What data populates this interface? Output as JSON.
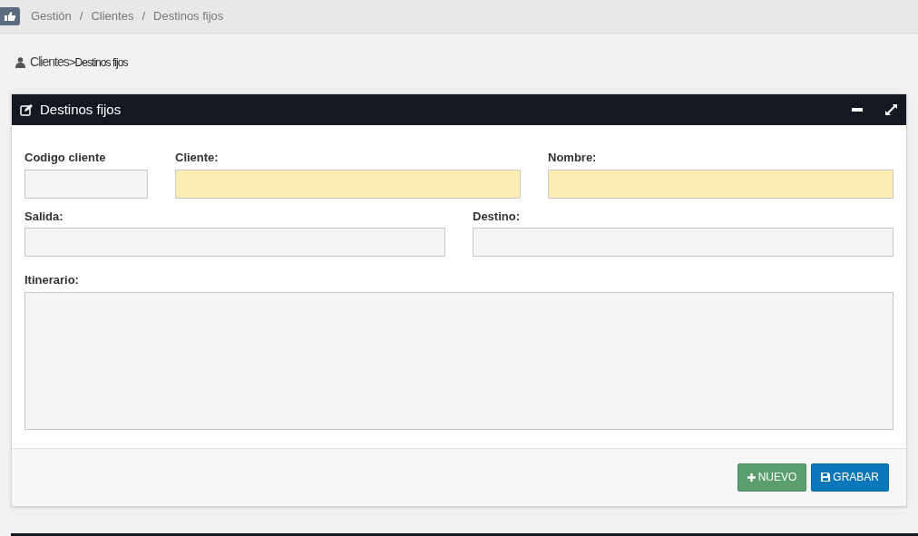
{
  "breadcrumb": [
    "Gestión",
    "/",
    "Clientes",
    "/",
    "Destinos fijos"
  ],
  "page_path": {
    "section": "Clientes",
    "separator": ">",
    "current": "Destinos fijos"
  },
  "panel": {
    "title": "Destinos fijos",
    "rows": [
      [
        {
          "label": "Codigo cliente",
          "highlighted": false
        },
        {
          "label": "Cliente:",
          "highlighted": true
        },
        {
          "label": "Nombre:",
          "highlighted": true
        }
      ],
      [
        {
          "label": "Salida:",
          "highlighted": false
        },
        {
          "label": "Destino:",
          "highlighted": false
        }
      ]
    ],
    "textarea": {
      "label": "Itinerario:"
    },
    "buttons": [
      {
        "label": "NUEVO",
        "kind": "add"
      },
      {
        "label": "GRABAR",
        "kind": "save"
      }
    ]
  }
}
